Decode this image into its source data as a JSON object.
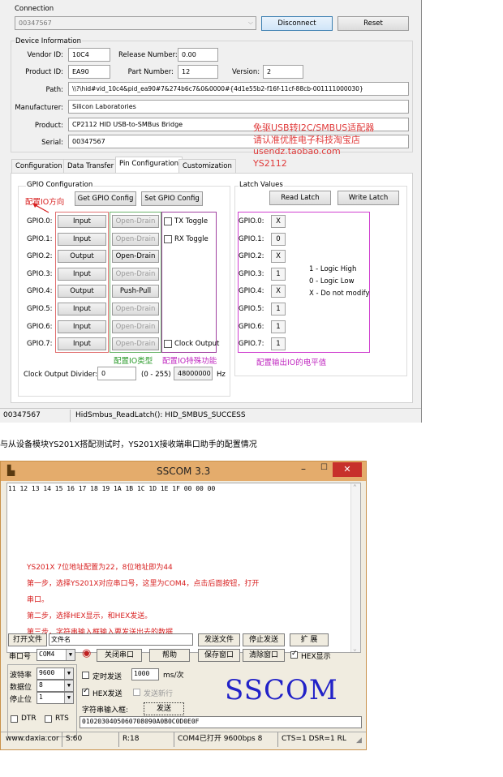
{
  "connection": {
    "group_label": "Connection",
    "device_serial": "00347567",
    "disconnect_label": "Disconnect",
    "reset_label": "Reset"
  },
  "device_info": {
    "group_label": "Device Information",
    "vendor_id_label": "Vendor ID:",
    "vendor_id": "10C4",
    "release_number_label": "Release Number:",
    "release_number": "0.00",
    "product_id_label": "Product ID:",
    "product_id": "EA90",
    "part_number_label": "Part Number:",
    "part_number": "12",
    "version_label": "Version:",
    "version": "2",
    "path_label": "Path:",
    "path": "\\\\?\\hid#vid_10c4&pid_ea90#7&274b6c7&0&0000#{4d1e55b2-f16f-11cf-88cb-001111000030}",
    "manufacturer_label": "Manufacturer:",
    "manufacturer": "Silicon Laboratories",
    "product_label": "Product:",
    "product": "CP2112 HID USB-to-SMBus Bridge",
    "serial_label": "Serial:",
    "serial": "00347567"
  },
  "overlay_ad": {
    "line1": "免驱USB转I2C/SMBUS适配器",
    "line2": "请认准优胜电子科技淘宝店",
    "line3": "usendz.taobao.com",
    "line4": "YS2112"
  },
  "tabs": [
    {
      "label": "Configuration"
    },
    {
      "label": "Data Transfer"
    },
    {
      "label": "Pin Configuration"
    },
    {
      "label": "Customization"
    }
  ],
  "gpio_config": {
    "group_label": "GPIO Configuration",
    "direction_note": "配置IO方向",
    "get_label": "Get GPIO Config",
    "set_label": "Set GPIO Config",
    "pins": [
      {
        "name": "GPIO.0:",
        "dir": "Input",
        "mode": "Open-Drain",
        "mode_enabled": false,
        "special": "TX Toggle"
      },
      {
        "name": "GPIO.1:",
        "dir": "Input",
        "mode": "Open-Drain",
        "mode_enabled": false,
        "special": "RX Toggle"
      },
      {
        "name": "GPIO.2:",
        "dir": "Output",
        "mode": "Open-Drain",
        "mode_enabled": true,
        "special": ""
      },
      {
        "name": "GPIO.3:",
        "dir": "Input",
        "mode": "Open-Drain",
        "mode_enabled": false,
        "special": ""
      },
      {
        "name": "GPIO.4:",
        "dir": "Output",
        "mode": "Push-Pull",
        "mode_enabled": true,
        "special": ""
      },
      {
        "name": "GPIO.5:",
        "dir": "Input",
        "mode": "Open-Drain",
        "mode_enabled": false,
        "special": ""
      },
      {
        "name": "GPIO.6:",
        "dir": "Input",
        "mode": "Open-Drain",
        "mode_enabled": false,
        "special": ""
      },
      {
        "name": "GPIO.7:",
        "dir": "Input",
        "mode": "Open-Drain",
        "mode_enabled": false,
        "special": "Clock Output"
      }
    ],
    "type_note": "配置IO类型",
    "special_note": "配置IO特殊功能",
    "clock_divider_label": "Clock Output Divider:",
    "clock_divider": "0",
    "clock_range": "(0 - 255)",
    "clock_freq": "48000000",
    "clock_unit": "Hz"
  },
  "latch": {
    "group_label": "Latch Values",
    "read_label": "Read Latch",
    "write_label": "Write Latch",
    "values": [
      {
        "name": "GPIO.0:",
        "val": "X"
      },
      {
        "name": "GPIO.1:",
        "val": "0"
      },
      {
        "name": "GPIO.2:",
        "val": "X"
      },
      {
        "name": "GPIO.3:",
        "val": "1"
      },
      {
        "name": "GPIO.4:",
        "val": "X"
      },
      {
        "name": "GPIO.5:",
        "val": "1"
      },
      {
        "name": "GPIO.6:",
        "val": "1"
      },
      {
        "name": "GPIO.7:",
        "val": "1"
      }
    ],
    "legend": [
      "1 - Logic High",
      "0 - Logic Low",
      "X - Do not modify"
    ],
    "note": "配置输出IO的电平值"
  },
  "status_bar": {
    "serial": "00347567",
    "message": "HidSmbus_ReadLatch(): HID_SMBUS_SUCCESS"
  },
  "caption": "与从设备模块YS201X搭配测试时，YS201X接收端串口助手的配置情况",
  "sscom": {
    "title": "SSCOM 3.3",
    "received": "11 12 13 14 15 16 17 18 19 1A 1B 1C 1D 1E 1F 00 00 00",
    "notes": [
      "YS201X 7位地址配置为22，8位地址即为44",
      "第一步，选择YS201X对应串口号，这里为COM4，点击后面按钮，打开",
      "串口。",
      "第二步，选择HEX显示，和HEX发送。",
      "第三步，字符串输入框输入要发送出去的数据"
    ],
    "open_file_label": "打开文件",
    "file_name": "文件名",
    "send_file_label": "发送文件",
    "stop_send_label": "停止发送",
    "expand_label": "扩 展",
    "port_label": "串口号",
    "port_value": "COM4",
    "close_port_label": "关闭串口",
    "help_label": "帮助",
    "save_window_label": "保存窗口",
    "clear_window_label": "清除窗口",
    "hex_display_label": "HEX显示",
    "baud_label": "波特率",
    "baud_value": "9600",
    "data_bits_label": "数据位",
    "data_bits_value": "8",
    "stop_bits_label": "停止位",
    "stop_bits_value": "1",
    "timed_send_label": "定时发送",
    "interval_value": "1000",
    "interval_unit": "ms/次",
    "hex_send_label": "HEX发送",
    "send_newline_label": "发送新行",
    "input_label": "字符串输入框:",
    "send_label": "发送",
    "dtr_label": "DTR",
    "rts_label": "RTS",
    "input_value": "0102030405060708090A0B0C0D0E0F",
    "logo": "SSCOM",
    "status": [
      "www.daxia.cor",
      "S:60",
      "R:18",
      "COM4已打开  9600bps  8",
      "CTS=1 DSR=1 RL"
    ]
  }
}
